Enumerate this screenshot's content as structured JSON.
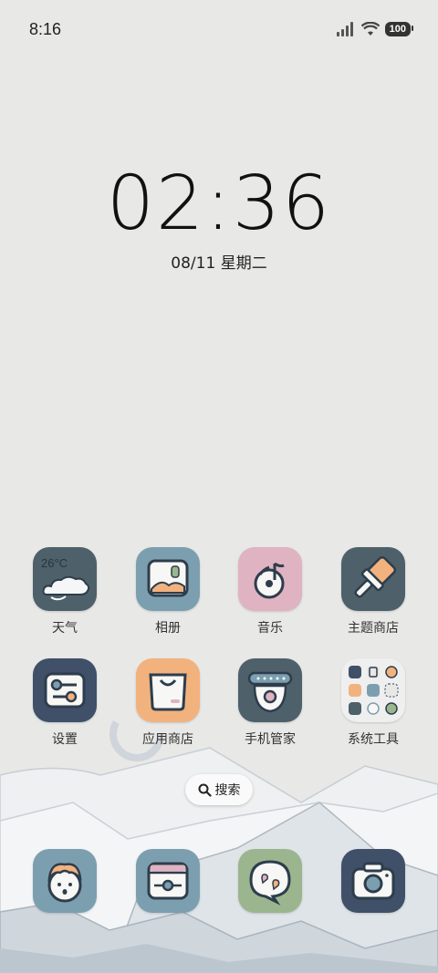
{
  "status_bar": {
    "time": "8:16",
    "battery": "100"
  },
  "clock": {
    "time": "02:36",
    "date": "08/11 星期二"
  },
  "weather_widget": {
    "temperature": "26°C"
  },
  "apps_row1": [
    {
      "label": "天气"
    },
    {
      "label": "相册"
    },
    {
      "label": "音乐"
    },
    {
      "label": "主题商店"
    }
  ],
  "apps_row2": [
    {
      "label": "设置"
    },
    {
      "label": "应用商店"
    },
    {
      "label": "手机管家"
    },
    {
      "label": "系统工具"
    }
  ],
  "search": {
    "label": "搜索"
  },
  "colors": {
    "navy": "#3f5068",
    "blue_gray": "#7c9fb0",
    "pink": "#e0b3c2",
    "slate": "#4e6069",
    "orange": "#f2b27e",
    "green": "#9bb68e"
  }
}
